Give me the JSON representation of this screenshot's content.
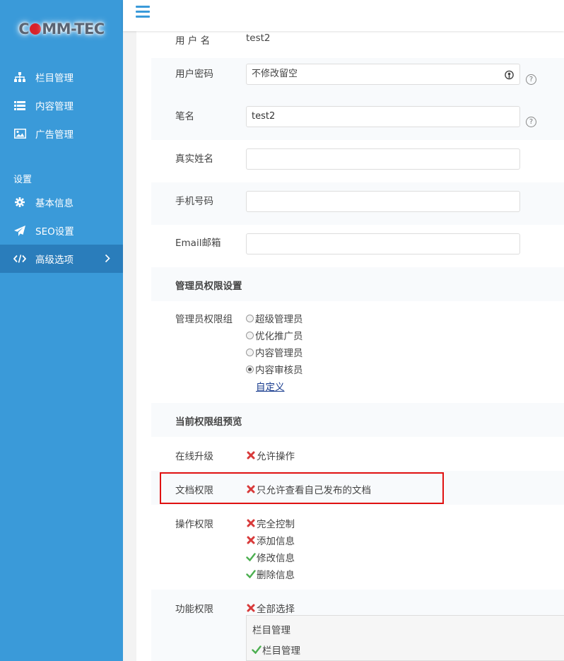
{
  "logo": {
    "left": "C",
    "right": "MM-TEC"
  },
  "sidebar": {
    "items": [
      {
        "label": "栏目管理",
        "icon": "sitemap-icon"
      },
      {
        "label": "内容管理",
        "icon": "list-icon"
      },
      {
        "label": "广告管理",
        "icon": "image-icon"
      }
    ],
    "section": "设置",
    "settings": [
      {
        "label": "基本信息",
        "icon": "gear-icon"
      },
      {
        "label": "SEO设置",
        "icon": "paper-plane-icon"
      },
      {
        "label": "高级选项",
        "icon": "code-icon",
        "active": true
      }
    ]
  },
  "form": {
    "username_label": "用 户 名",
    "username_value": "test2",
    "password_label": "用户密码",
    "password_placeholder": "不修改留空",
    "nickname_label": "笔名",
    "nickname_value": "test2",
    "realname_label": "真实姓名",
    "phone_label": "手机号码",
    "email_label": "Email邮箱",
    "help_glyph": "?"
  },
  "admin": {
    "section_title": "管理员权限设置",
    "group_label": "管理员权限组",
    "groups": [
      "超级管理员",
      "优化推广员",
      "内容管理员",
      "内容审核员"
    ],
    "selected_index": 3,
    "custom_link": "自定义"
  },
  "preview": {
    "section_title": "当前权限组预览",
    "online_label": "在线升级",
    "online_items": [
      {
        "text": "允许操作",
        "allowed": false
      }
    ],
    "doc_label": "文档权限",
    "doc_items": [
      {
        "text": "只允许查看自己发布的文档",
        "allowed": false
      }
    ],
    "op_label": "操作权限",
    "op_items": [
      {
        "text": "完全控制",
        "allowed": false
      },
      {
        "text": "添加信息",
        "allowed": false
      },
      {
        "text": "修改信息",
        "allowed": true
      },
      {
        "text": "删除信息",
        "allowed": true
      }
    ],
    "func_label": "功能权限",
    "func_items": [
      {
        "text": "全部选择",
        "allowed": false
      }
    ],
    "func_sub_title": "栏目管理",
    "func_sub_items": [
      {
        "text": "栏目管理",
        "allowed": true
      }
    ]
  },
  "colors": {
    "sidebar": "#3a9ad9",
    "active": "#2a7dbb",
    "deny": "#d83a3a",
    "allow": "#4caf50",
    "highlight": "#e01111"
  }
}
